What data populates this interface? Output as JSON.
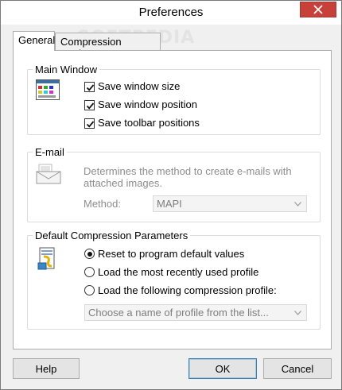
{
  "window": {
    "title": "Preferences",
    "close_label": "×"
  },
  "tabs": [
    {
      "label": "General",
      "active": true
    },
    {
      "label": "Compression Engine",
      "active": false
    }
  ],
  "main_window": {
    "legend": "Main Window",
    "checks": [
      {
        "label": "Save window size",
        "checked": true
      },
      {
        "label": "Save window position",
        "checked": true
      },
      {
        "label": "Save toolbar positions",
        "checked": true
      }
    ]
  },
  "email": {
    "legend": "E-mail",
    "description_line1": "Determines the method to create e-mails with",
    "description_line2": "attached images.",
    "method_label": "Method:",
    "method_value": "MAPI"
  },
  "compression": {
    "legend": "Default Compression Parameters",
    "options": [
      {
        "label": "Reset to program default values",
        "checked": true
      },
      {
        "label": "Load the most recently used profile",
        "checked": false
      },
      {
        "label": "Load the following compression profile:",
        "checked": false
      }
    ],
    "profile_placeholder": "Choose a name of profile from the list..."
  },
  "buttons": {
    "help": "Help",
    "ok": "OK",
    "cancel": "Cancel"
  },
  "watermark": "SOFTPEDIA",
  "colors": {
    "close_button": "#c7403a",
    "default_button_border": "#3c7fb1"
  }
}
